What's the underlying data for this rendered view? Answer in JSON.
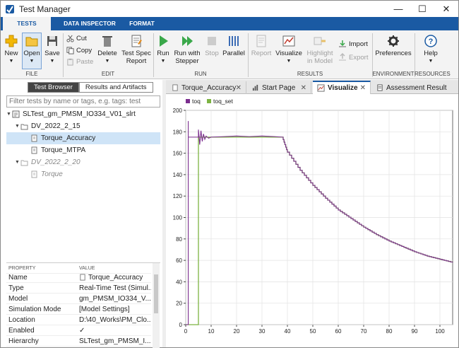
{
  "window": {
    "title": "Test Manager",
    "minimize": "—",
    "maximize": "☐",
    "close": "✕"
  },
  "ribbon_tabs": [
    "TESTS",
    "DATA INSPECTOR",
    "FORMAT"
  ],
  "ribbon": {
    "new": "New",
    "open": "Open",
    "save": "Save",
    "cut": "Cut",
    "copy": "Copy",
    "paste": "Paste",
    "delete": "Delete",
    "test_spec_report_1": "Test Spec",
    "test_spec_report_2": "Report",
    "run": "Run",
    "run_stepper_1": "Run with",
    "run_stepper_2": "Stepper",
    "stop": "Stop",
    "parallel": "Parallel",
    "report": "Report",
    "visualize": "Visualize",
    "highlight_1": "Highlight",
    "highlight_2": "in Model",
    "import": "Import",
    "export": "Export",
    "preferences": "Preferences",
    "help": "Help",
    "groups": {
      "file": "FILE",
      "edit": "EDIT",
      "run": "RUN",
      "results": "RESULTS",
      "environment": "ENVIRONMENT",
      "resources": "RESOURCES"
    }
  },
  "left_panel": {
    "tabs": [
      "Test Browser",
      "Results and Artifacts"
    ],
    "filter_placeholder": "Filter tests by name or tags, e.g. tags: test",
    "tree": [
      {
        "label": "SLTest_gm_PMSM_IO334_V01_slrt"
      },
      {
        "label": "DV_2022_2_15"
      },
      {
        "label": "Torque_Accuracy"
      },
      {
        "label": "Torque_MTPA"
      },
      {
        "label": "DV_2022_2_20"
      },
      {
        "label": "Torque"
      }
    ],
    "props_header": {
      "key": "PROPERTY",
      "value": "VALUE"
    },
    "props": [
      {
        "key": "Name",
        "value": "Torque_Accuracy"
      },
      {
        "key": "Type",
        "value": "Real-Time Test (Simul..."
      },
      {
        "key": "Model",
        "value": "gm_PMSM_IO334_V..."
      },
      {
        "key": "Simulation Mode",
        "value": "[Model Settings]"
      },
      {
        "key": "Location",
        "value": "D:\\40_Works\\PM_Clo..."
      },
      {
        "key": "Enabled",
        "value": "✓"
      },
      {
        "key": "Hierarchy",
        "value": "SLTest_gm_PMSM_I..."
      }
    ]
  },
  "doc_tabs": [
    "Torque_Accuracy",
    "Start Page",
    "Visualize",
    "Assessment Result"
  ],
  "doc_tab_close": "✕",
  "colors": {
    "toq": "#7b2d8e",
    "toq_set": "#7cb342",
    "accent": "#1a5aa3"
  },
  "chart_data": {
    "type": "line",
    "legend": [
      "toq",
      "toq_set"
    ],
    "legend_position": "top-left",
    "grid": true,
    "xlim": [
      0,
      105
    ],
    "ylim": [
      0,
      200
    ],
    "xticks": [
      0,
      10,
      20,
      30,
      40,
      50,
      60,
      70,
      80,
      90,
      100
    ],
    "yticks": [
      0,
      20,
      40,
      60,
      80,
      100,
      120,
      140,
      160,
      180,
      200
    ],
    "series": [
      {
        "name": "toq",
        "x": [
          0,
          1,
          1,
          1,
          2,
          5,
          5,
          5.5,
          6,
          6.5,
          7,
          7.5,
          8,
          9,
          10,
          15,
          20,
          25,
          30,
          35,
          38,
          40,
          45,
          50,
          55,
          60,
          65,
          70,
          75,
          80,
          85,
          90,
          95,
          100,
          105
        ],
        "y": [
          0,
          0,
          190,
          175,
          175,
          175,
          182,
          168,
          181,
          171,
          178,
          173,
          176,
          174,
          175,
          175.5,
          176,
          175.5,
          176,
          175.5,
          175,
          161,
          144,
          130,
          118,
          107,
          99,
          91,
          84,
          78,
          73,
          68,
          64,
          61,
          58
        ]
      },
      {
        "name": "toq_set",
        "x": [
          0,
          5,
          5,
          10,
          15,
          20,
          25,
          30,
          35,
          38,
          40,
          45,
          50,
          55,
          60,
          65,
          70,
          75,
          80,
          85,
          90,
          95,
          100,
          105
        ],
        "y": [
          0,
          0,
          175,
          175,
          175,
          175,
          175,
          175,
          175,
          175,
          161,
          144,
          130,
          118,
          107,
          99,
          91,
          84,
          78,
          73,
          68,
          64,
          61,
          58
        ]
      }
    ]
  }
}
